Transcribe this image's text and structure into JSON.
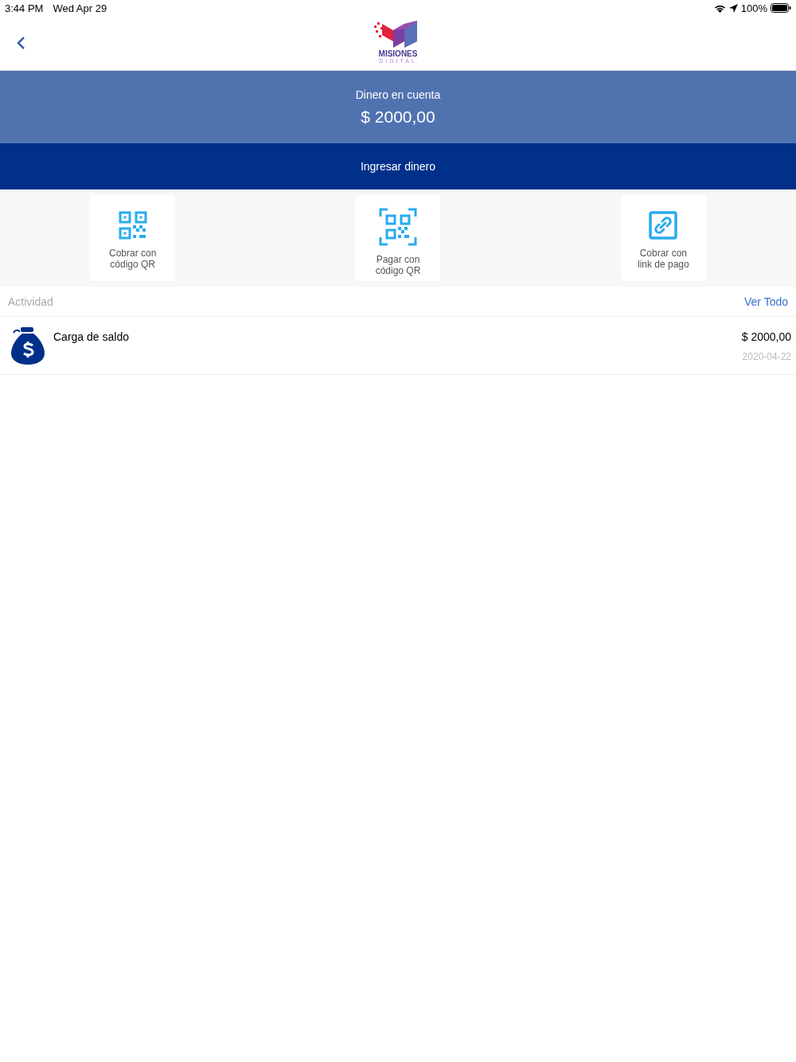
{
  "status_bar": {
    "time": "3:44 PM",
    "date": "Wed Apr 29",
    "battery": "100%"
  },
  "logo": {
    "name": "MISIONES",
    "subtitle": "DIGITAL"
  },
  "balance": {
    "label": "Dinero en cuenta",
    "amount": "$ 2000,00"
  },
  "deposit_button": "Ingresar dinero",
  "actions": [
    {
      "kind": "qr",
      "label": "Cobrar con código QR"
    },
    {
      "kind": "scan",
      "label": "Pagar con código QR"
    },
    {
      "kind": "link",
      "label": "Cobrar con link de pago"
    }
  ],
  "activity": {
    "title": "Actividad",
    "see_all": "Ver Todo",
    "items": [
      {
        "title": "Carga de saldo",
        "amount": "$ 2000,00",
        "date": "2020-04-22"
      }
    ]
  }
}
